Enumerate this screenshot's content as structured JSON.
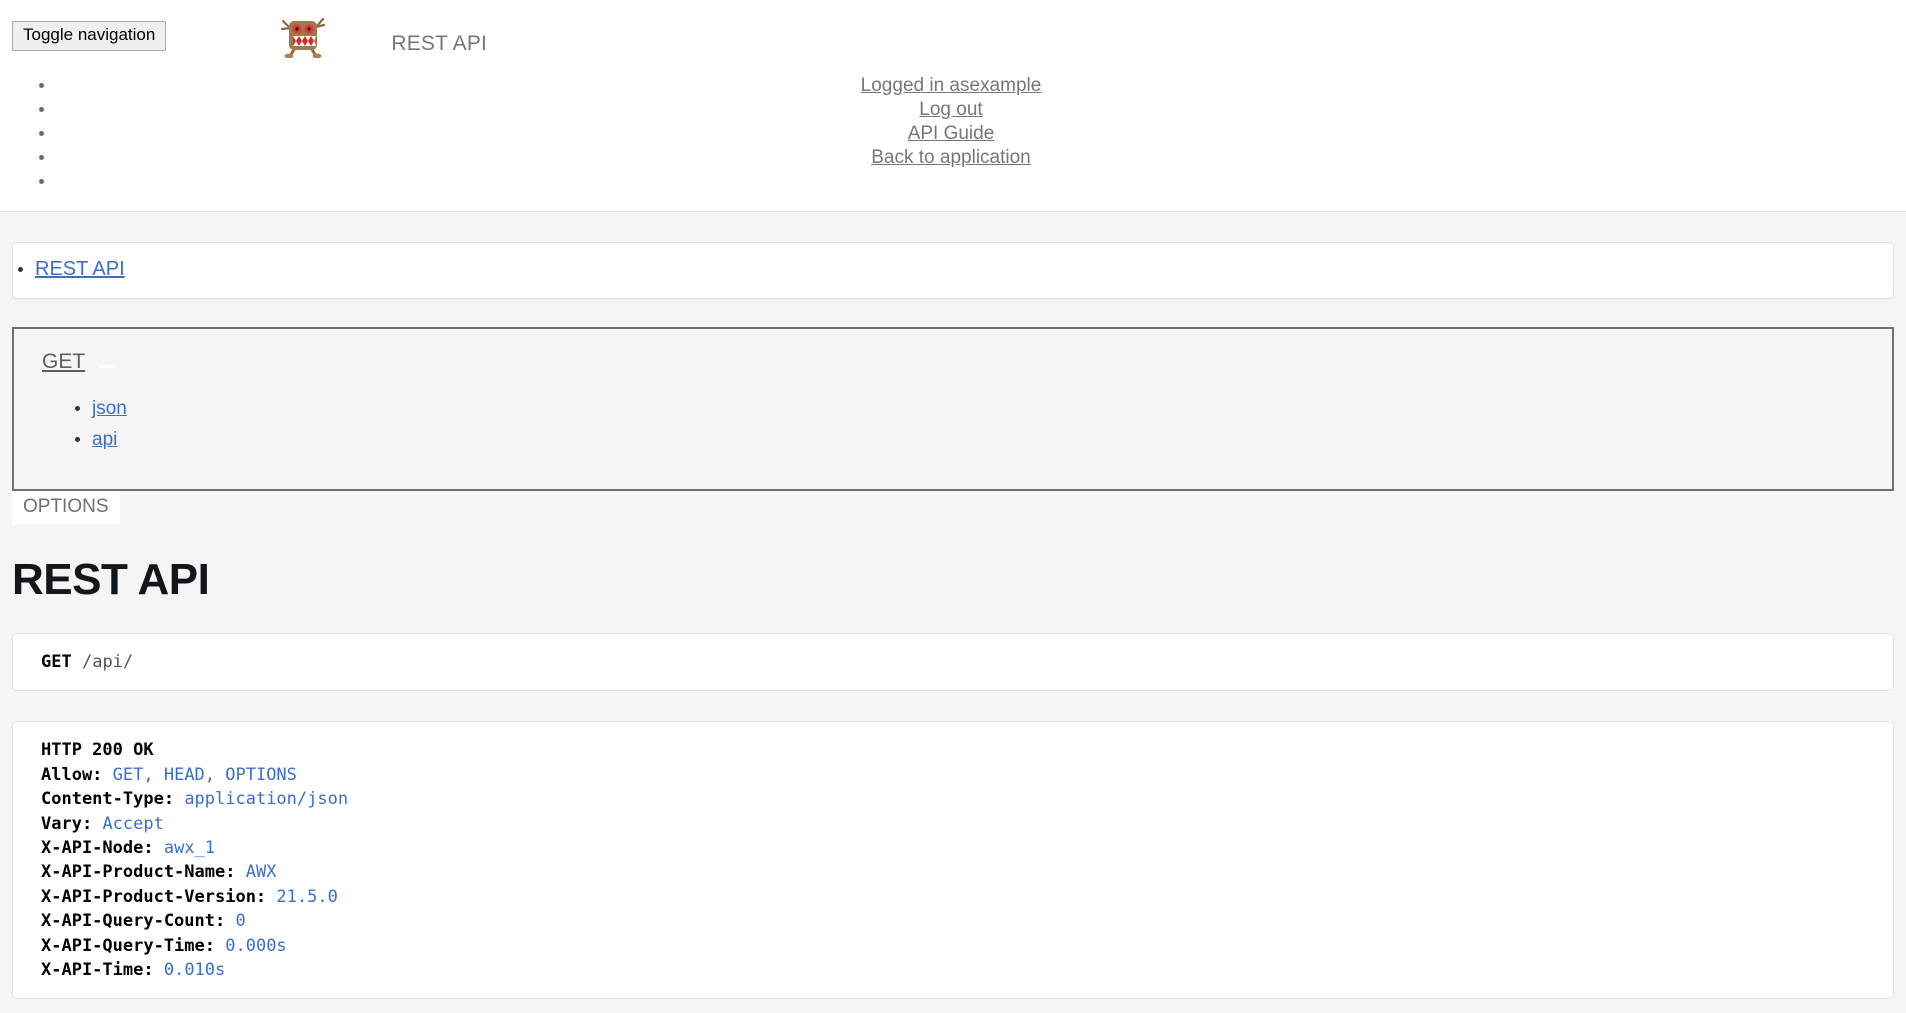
{
  "navbar": {
    "toggle_label": "Toggle navigation",
    "brand_logo_icon": "awx-domo-mascot-logo",
    "brand_text": "REST API",
    "links": [
      {
        "label": "Logged in asexample",
        "name": "logged-in-as"
      },
      {
        "label": "Log out",
        "name": "log-out"
      },
      {
        "label": "API Guide",
        "name": "api-guide"
      },
      {
        "label": "Back to application",
        "name": "back-to-application"
      }
    ]
  },
  "breadcrumb": {
    "items": [
      {
        "label": "REST API"
      }
    ]
  },
  "request_panel": {
    "method_button": "GET",
    "caret_icon": "caret-down-icon",
    "formats": [
      {
        "label": "json"
      },
      {
        "label": "api"
      }
    ],
    "options_button": "OPTIONS"
  },
  "page": {
    "title": "REST API"
  },
  "request": {
    "method": "GET",
    "path": "/api/"
  },
  "response": {
    "status_line": "HTTP 200 OK",
    "headers": [
      {
        "name": "Allow:",
        "value": "GET, HEAD, OPTIONS"
      },
      {
        "name": "Content-Type:",
        "value": "application/json"
      },
      {
        "name": "Vary:",
        "value": "Accept"
      },
      {
        "name": "X-API-Node:",
        "value": "awx_1"
      },
      {
        "name": "X-API-Product-Name:",
        "value": "AWX"
      },
      {
        "name": "X-API-Product-Version:",
        "value": "21.5.0"
      },
      {
        "name": "X-API-Query-Count:",
        "value": "0"
      },
      {
        "name": "X-API-Query-Time:",
        "value": "0.000s"
      },
      {
        "name": "X-API-Time:",
        "value": "0.010s"
      }
    ]
  },
  "colors": {
    "link_blue": "#3a6fc4",
    "literal_blue": "#3c6ec8",
    "muted_gray": "#777777",
    "page_bg": "#f5f5f5"
  }
}
